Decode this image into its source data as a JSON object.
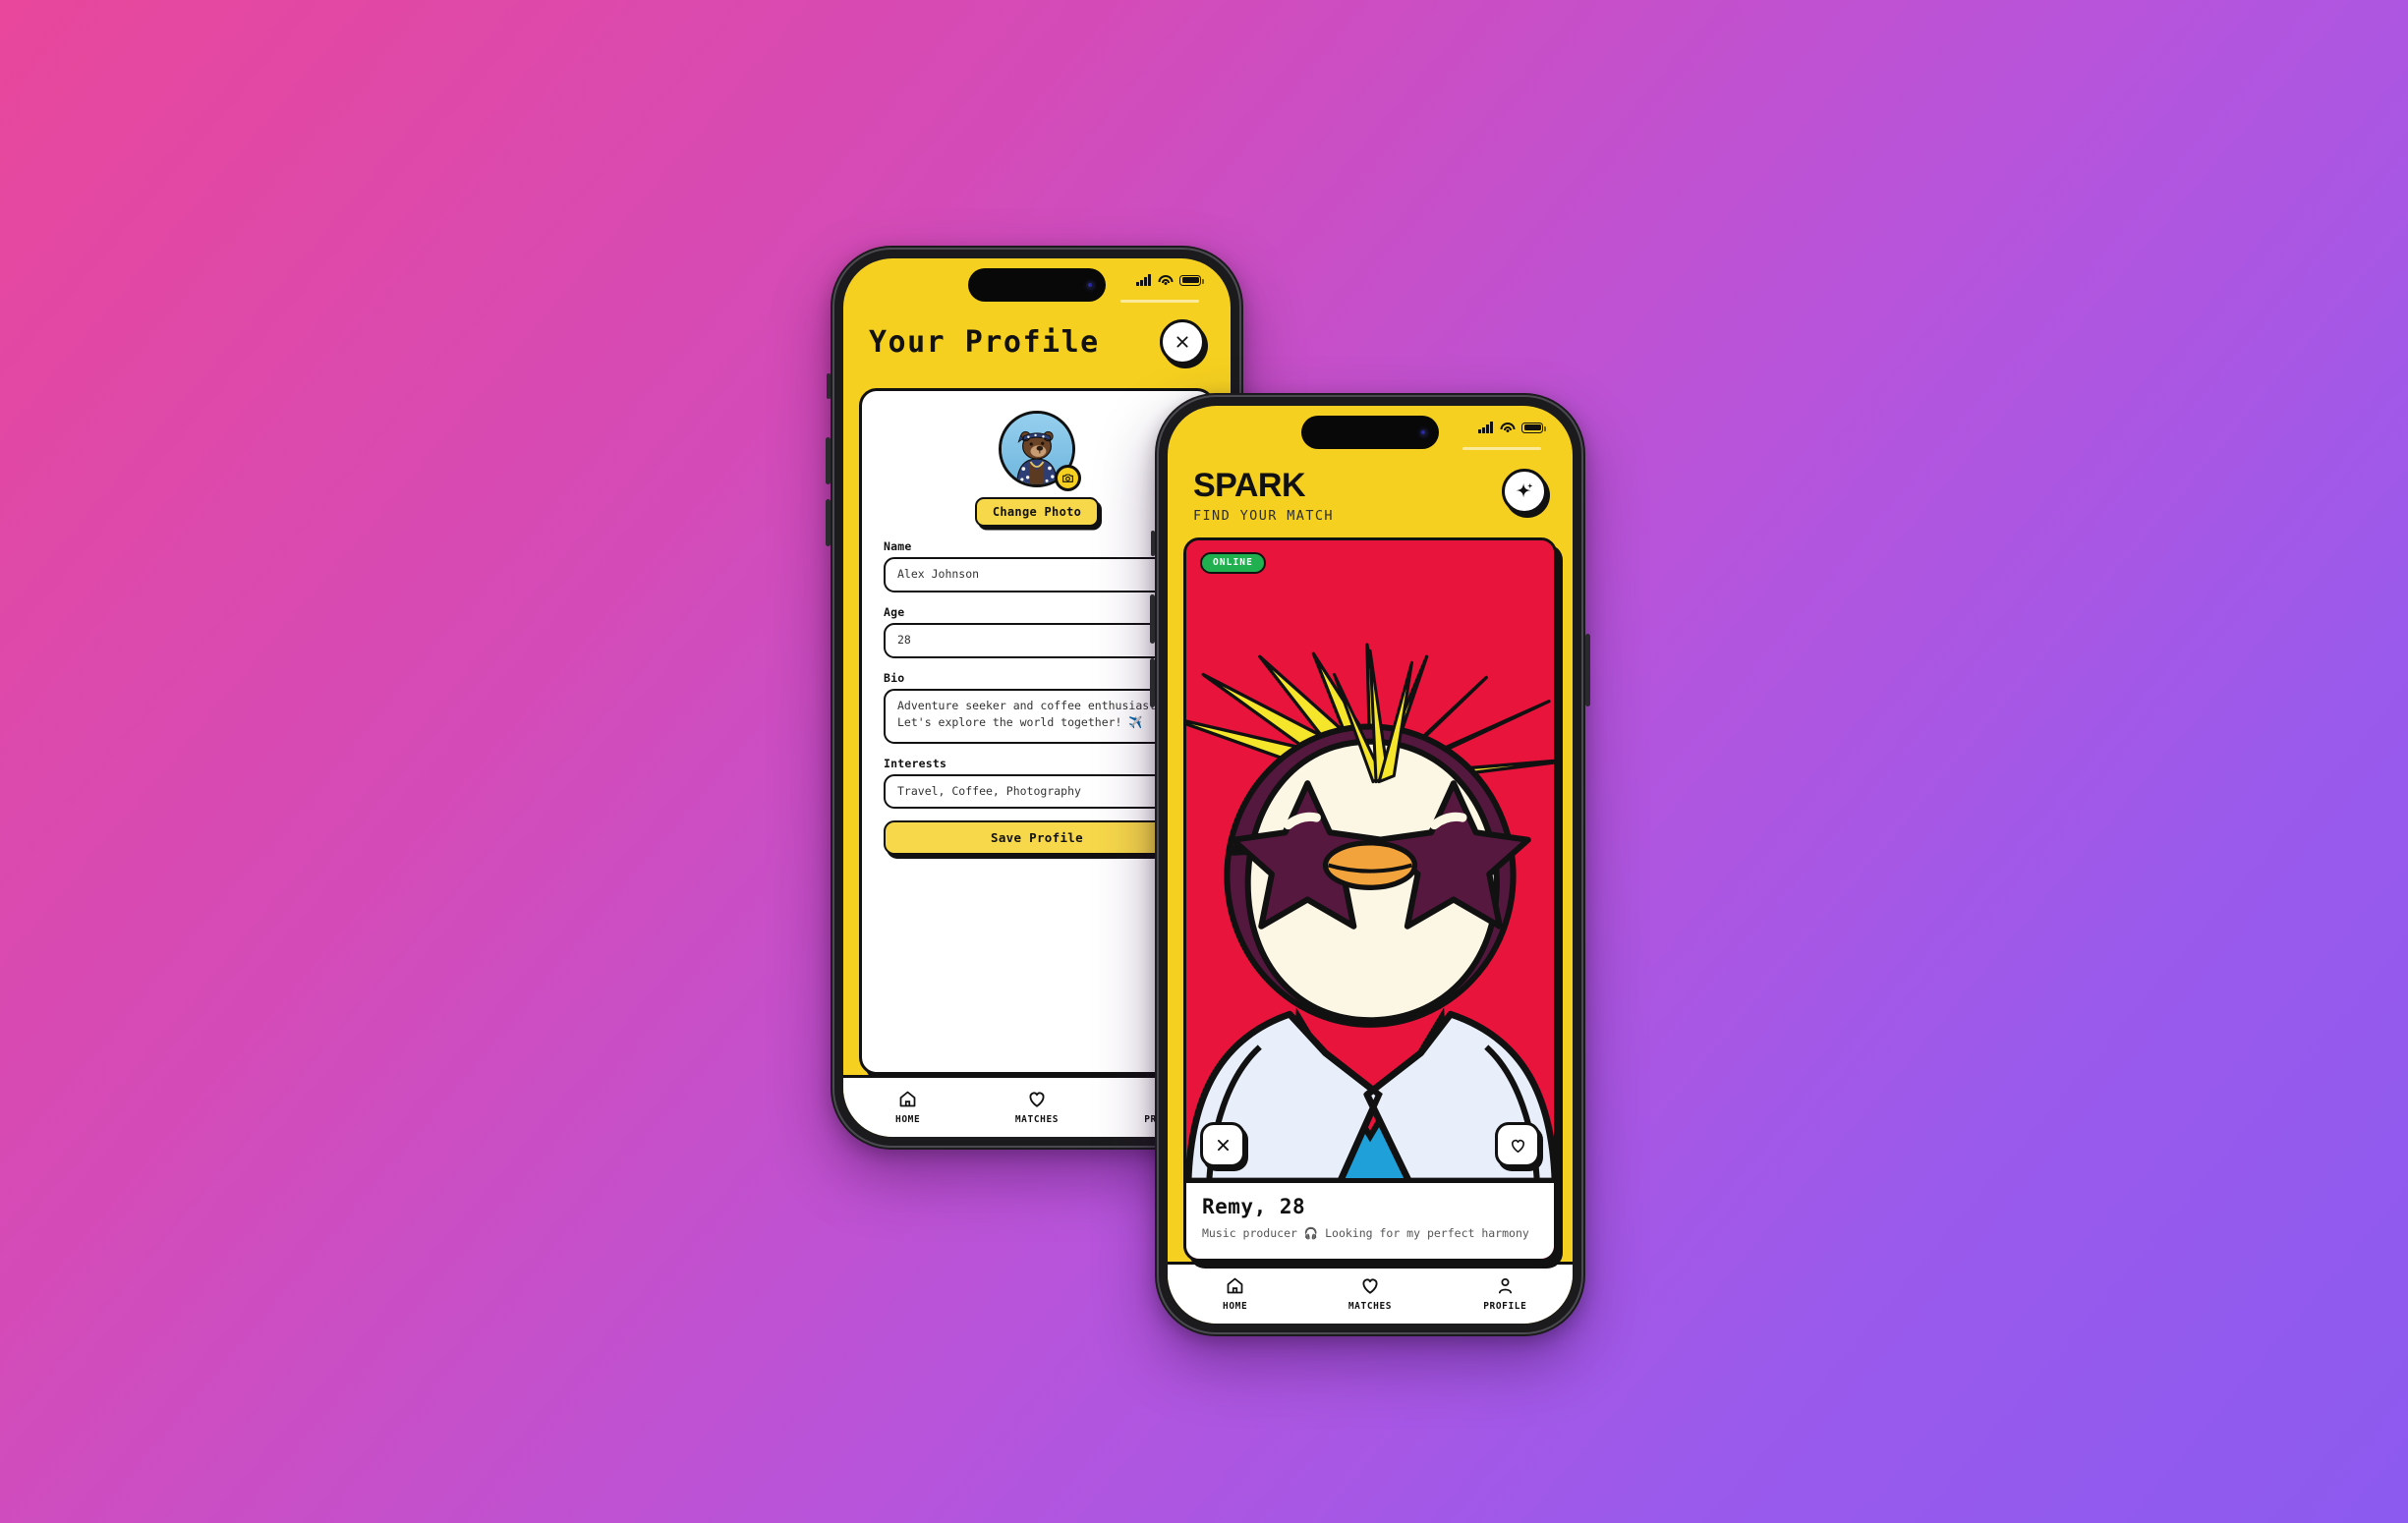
{
  "background": {
    "gradient_from": "#E8479B",
    "gradient_to": "#8C5AEF"
  },
  "theme": {
    "yellow": "#F5D020",
    "ink": "#111111",
    "card_red": "#E8143C",
    "online_green": "#20B04F",
    "button_yellow": "#F7D84A"
  },
  "back_phone": {
    "status_bar": {
      "signal_icon": "cellular-bars-icon",
      "wifi_icon": "wifi-icon",
      "battery_icon": "battery-icon"
    },
    "header": {
      "title": "Your Profile",
      "close_icon": "close-icon"
    },
    "profile": {
      "avatar_alt": "bear-avatar",
      "camera_icon": "camera-icon",
      "change_photo_label": "Change Photo",
      "fields": [
        {
          "label": "Name",
          "value": "Alex Johnson"
        },
        {
          "label": "Age",
          "value": "28"
        },
        {
          "label": "Bio",
          "value": "Adventure seeker and coffee enthusiast. Let's explore the world together! ✈️"
        },
        {
          "label": "Interests",
          "value": "Travel, Coffee, Photography"
        }
      ],
      "save_label": "Save Profile"
    },
    "tabbar": [
      {
        "icon": "home-icon",
        "label": "HOME"
      },
      {
        "icon": "heart-icon",
        "label": "MATCHES"
      },
      {
        "icon": "person-icon",
        "label": "PROFILE"
      }
    ]
  },
  "front_phone": {
    "status_bar": {
      "signal_icon": "cellular-bars-icon",
      "wifi_icon": "wifi-icon",
      "battery_icon": "battery-icon"
    },
    "header": {
      "title": "SPARK",
      "subtitle": "FIND YOUR MATCH",
      "sparkle_icon": "sparkle-icon"
    },
    "match_card": {
      "status_badge": "ONLINE",
      "photo_alt": "penguin-rockstar-photo",
      "pass_icon": "close-icon",
      "like_icon": "heart-icon",
      "name": "Remy, 28",
      "bio": "Music producer 🎧 Looking for my perfect harmony"
    },
    "tabbar": [
      {
        "icon": "home-icon",
        "label": "HOME"
      },
      {
        "icon": "heart-icon",
        "label": "MATCHES"
      },
      {
        "icon": "person-icon",
        "label": "PROFILE"
      }
    ]
  }
}
